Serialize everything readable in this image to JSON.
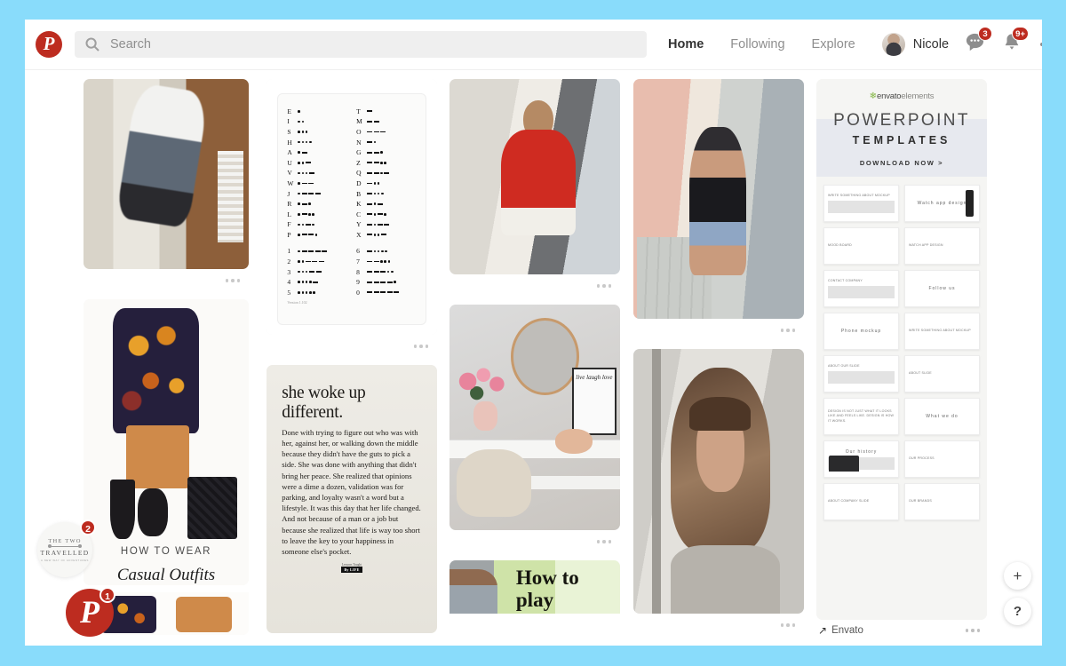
{
  "app": {
    "name": "Pinterest",
    "logo_icon": "pinterest-logo-icon",
    "logo_glyph": "P",
    "brand_color": "#bd2c20",
    "page_bg": "#89dcfb"
  },
  "header": {
    "search": {
      "icon": "search-icon",
      "placeholder": "Search",
      "value": ""
    },
    "nav": [
      {
        "label": "Home",
        "active": true
      },
      {
        "label": "Following",
        "active": false
      },
      {
        "label": "Explore",
        "active": false
      }
    ],
    "user": {
      "name": "Nicole",
      "avatar_icon": "avatar"
    },
    "icons": [
      {
        "name": "messages-icon",
        "badge": "3"
      },
      {
        "name": "notifications-bell-icon",
        "badge": "9+"
      }
    ],
    "overflow_label": "more-options-icon"
  },
  "overlays": {
    "travelled_badge": {
      "line1": "THE TWO",
      "line2": "TRAVELLED",
      "line3": "A NEW WAY OF ADVENTURES",
      "count": "2"
    },
    "pinterest_badge": {
      "glyph": "P",
      "count": "1"
    }
  },
  "fabs": [
    {
      "name": "create-pin-button",
      "glyph": "+"
    },
    {
      "name": "help-button",
      "glyph": "?"
    }
  ],
  "pins": {
    "selfie": {
      "kebab": "pin-options-icon"
    },
    "morse": {
      "kebab": "pin-options-icon",
      "footer": "Version 1.102",
      "left": [
        {
          "letter": "E",
          "code": "."
        },
        {
          "letter": "I",
          "code": ".."
        },
        {
          "letter": "S",
          "code": "..."
        },
        {
          "letter": "H",
          "code": "...."
        },
        {
          "letter": "A",
          "code": ".-"
        },
        {
          "letter": "U",
          "code": "..-"
        },
        {
          "letter": "V",
          "code": "...-"
        },
        {
          "letter": "W",
          "code": ".--"
        },
        {
          "letter": "J",
          "code": ".---"
        },
        {
          "letter": "R",
          "code": ".-."
        },
        {
          "letter": "L",
          "code": ".-.."
        },
        {
          "letter": "F",
          "code": "..-."
        },
        {
          "letter": "P",
          "code": ".--."
        }
      ],
      "right": [
        {
          "letter": "T",
          "code": "-"
        },
        {
          "letter": "M",
          "code": "--"
        },
        {
          "letter": "O",
          "code": "---"
        },
        {
          "letter": "N",
          "code": "-."
        },
        {
          "letter": "G",
          "code": "--."
        },
        {
          "letter": "Z",
          "code": "--.."
        },
        {
          "letter": "Q",
          "code": "--.-"
        },
        {
          "letter": "D",
          "code": "-.."
        },
        {
          "letter": "B",
          "code": "-..."
        },
        {
          "letter": "K",
          "code": "-.-"
        },
        {
          "letter": "C",
          "code": "-.-."
        },
        {
          "letter": "Y",
          "code": "-.--"
        },
        {
          "letter": "X",
          "code": "-..-"
        }
      ],
      "left_numbers": [
        {
          "letter": "1",
          "code": ".----"
        },
        {
          "letter": "2",
          "code": "..---"
        },
        {
          "letter": "3",
          "code": "...--"
        },
        {
          "letter": "4",
          "code": "....-"
        },
        {
          "letter": "5",
          "code": "....."
        }
      ],
      "right_numbers": [
        {
          "letter": "6",
          "code": "-...."
        },
        {
          "letter": "7",
          "code": "--..."
        },
        {
          "letter": "8",
          "code": "---.."
        },
        {
          "letter": "9",
          "code": "----."
        },
        {
          "letter": "0",
          "code": "-----"
        }
      ]
    },
    "red_top": {
      "kebab": "pin-options-icon"
    },
    "street_style": {
      "kebab": "pin-options-icon"
    },
    "envato": {
      "brand_leaf": "envato-leaf-icon",
      "brand_bold": "envato",
      "brand_light": "elements",
      "title": "POWERPOINT",
      "subtitle": "TEMPLATES",
      "cta": "DOWNLOAD NOW >",
      "attribution": "Envato",
      "attribution_icon": "external-link-arrow-icon",
      "kebab": "pin-options-icon",
      "slides": [
        "Write something about mockup",
        "Watch app design",
        "Mood board",
        "Watch app design",
        "Contact company",
        "Follow us",
        "Phone mockup",
        "Write something about mockup",
        "About our slide",
        "About slide",
        "Design is not just what it looks like and feels like. Design is how it works.",
        "What we do",
        "Our history",
        "Our process",
        "About company slide",
        "Our brands"
      ]
    },
    "floral_outfit": {
      "caption_top": "HOW TO WEAR",
      "caption_bottom": "Casual Outfits",
      "kebab": "pin-options-icon"
    },
    "quote": {
      "heading": "she woke up different.",
      "body": "Done with trying to figure out who was with her, against her, or walking down the middle because they didn't have the guts to pick a side. She was done with anything that didn't bring her peace. She realized that opinions were a dime a dozen, validation was for parking, and loyalty wasn't a word but a lifestyle. It was this day that her life changed. And not because of a man or a job but because she realized that life is way too short to leave the key to your happiness in someone else's pocket.",
      "credit": "Lessons Taught",
      "credit_brand": "By LIFE",
      "kebab": "pin-options-icon"
    },
    "vanity": {
      "art_text": "live laugh love",
      "kebab": "pin-options-icon"
    },
    "portrait": {
      "kebab": "pin-options-icon"
    },
    "how_to_play": {
      "title": "How to play"
    }
  }
}
